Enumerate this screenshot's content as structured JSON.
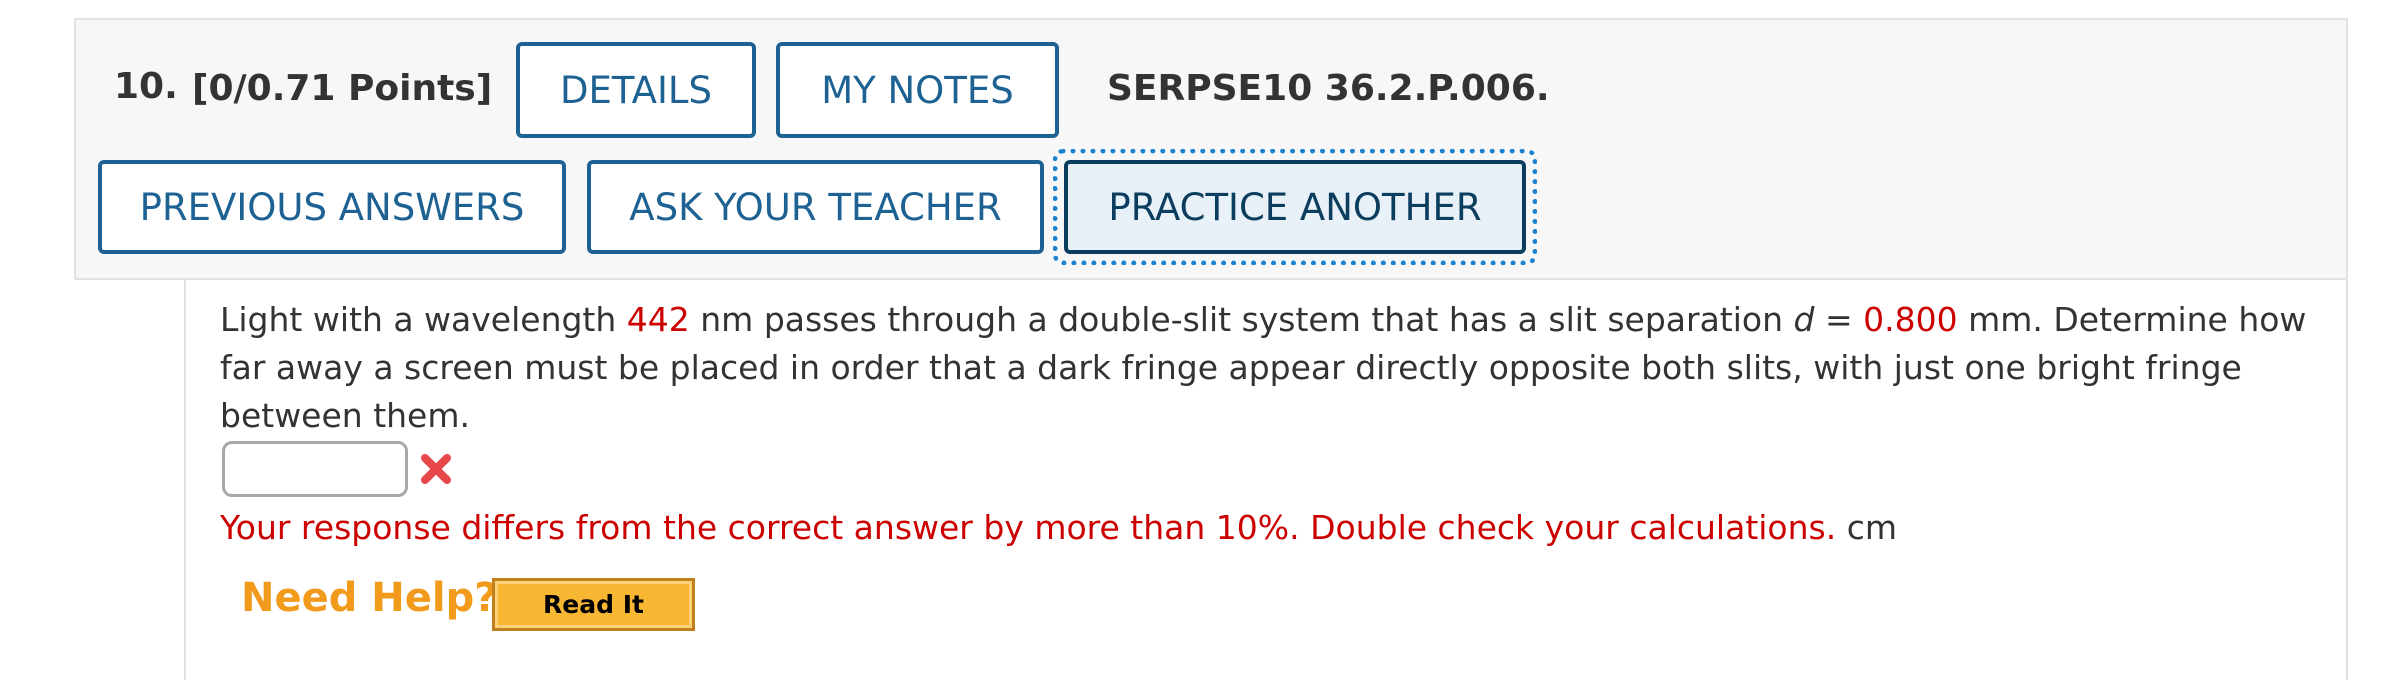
{
  "question": {
    "number": "10.",
    "points": "[0/0.71 Points]",
    "problem_id": "SERPSE10 36.2.P.006.",
    "text_part1": "Light with a wavelength ",
    "wavelength": "442",
    "text_part2": " nm passes through a double-slit system that has a slit separation ",
    "d_symbol": "d",
    "text_part3": " = ",
    "separation": "0.800",
    "text_part4": " mm. Determine how far away a screen must be placed in order that a dark fringe appear directly opposite both slits, with just one bright fringe between them."
  },
  "buttons": {
    "details": "DETAILS",
    "my_notes": "MY NOTES",
    "previous_answers": "PREVIOUS ANSWERS",
    "ask_teacher": "ASK YOUR TEACHER",
    "practice_another": "PRACTICE ANOTHER"
  },
  "answer": {
    "value": "",
    "status_icon": "incorrect-x-icon",
    "feedback": "Your response differs from the correct answer by more than 10%. Double check your calculations.",
    "unit": "cm"
  },
  "help": {
    "label": "Need Help?",
    "read_it": "Read It"
  },
  "colors": {
    "button_border": "#1d6293",
    "highlight_red": "#cc0000",
    "focus_ring": "#1a82d0",
    "need_help_orange": "#f29a1c",
    "read_it_fill": "#f7b733"
  }
}
